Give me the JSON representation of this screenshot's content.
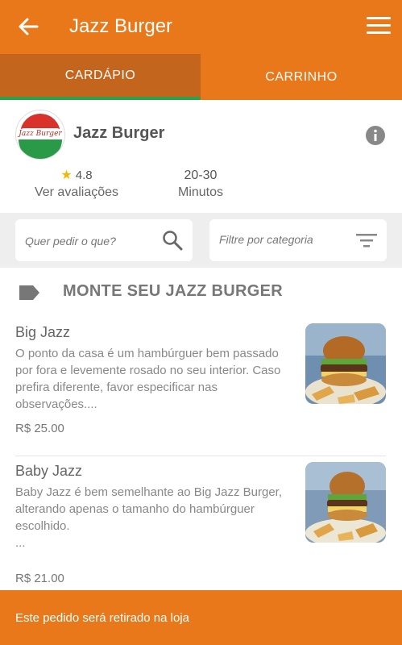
{
  "header": {
    "title": "Jazz Burger"
  },
  "tabs": [
    {
      "label": "CARDÁPIO",
      "active": true
    },
    {
      "label": "CARRINHO",
      "active": false
    }
  ],
  "store": {
    "name": "Jazz Burger",
    "rating": "4.8",
    "rating_link": "Ver avaliações",
    "delivery_time": "20-30",
    "delivery_unit": "Minutos",
    "logo_text": "Jazz Burger"
  },
  "search": {
    "placeholder": "Quer pedir o que?"
  },
  "category_filter": {
    "placeholder": "Filtre por categoria"
  },
  "section": {
    "title": "MONTE SEU JAZZ BURGER"
  },
  "items": [
    {
      "name": "Big Jazz",
      "description": "O ponto da casa é um hambúrguer bem passado por fora e levemente rosado no seu interior. Caso prefira diferente, favor especificar nas observações....",
      "price": "R$ 25.00"
    },
    {
      "name": "Baby Jazz",
      "description": "Baby Jazz é bem semelhante ao Big Jazz Burger, alterando apenas o tamanho do hambúrguer escolhido.",
      "description_extra": "...",
      "price": "R$ 21.00"
    }
  ],
  "footer": {
    "text": "Este pedido será retirado na loja"
  },
  "colors": {
    "brand": "#e8781a",
    "tab_active": "#c4651e",
    "tab_indicator": "#2ba34a"
  }
}
